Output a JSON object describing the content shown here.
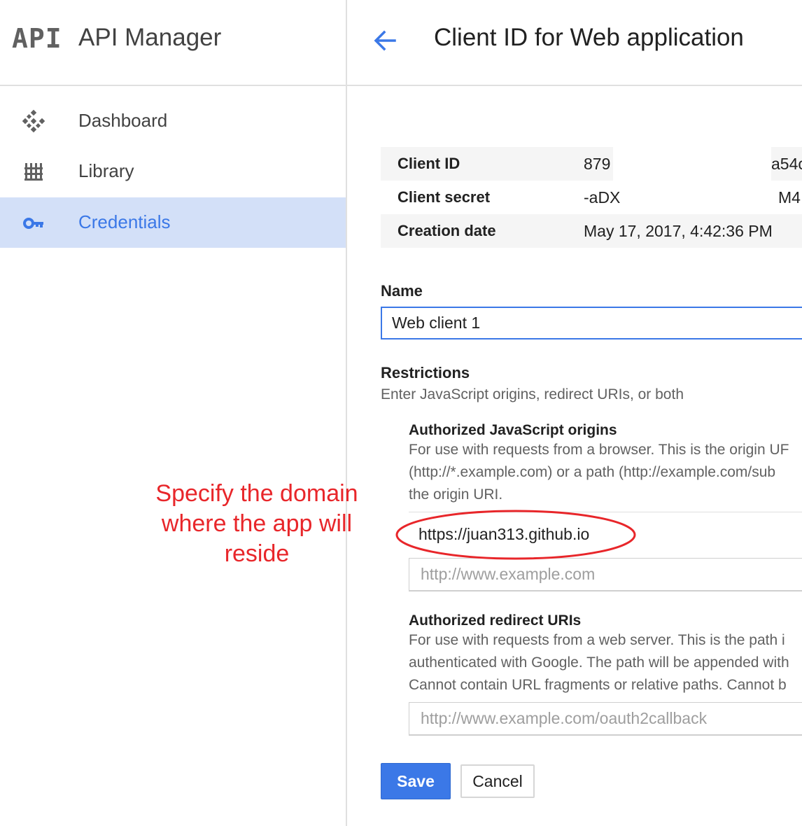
{
  "sidebar": {
    "logo": "API",
    "title": "API Manager",
    "items": [
      {
        "label": "Dashboard",
        "icon": "dashboard-icon"
      },
      {
        "label": "Library",
        "icon": "library-icon"
      },
      {
        "label": "Credentials",
        "icon": "key-icon",
        "active": true
      }
    ]
  },
  "header": {
    "title": "Client ID for Web application",
    "back_icon": "arrow-back-icon"
  },
  "info": {
    "rows": [
      {
        "key": "Client ID",
        "value": "879",
        "value_tail": "a54c"
      },
      {
        "key": "Client secret",
        "value": "-aDX",
        "value_tail": "M4"
      },
      {
        "key": "Creation date",
        "value": "May 17, 2017, 4:42:36 PM"
      }
    ]
  },
  "name": {
    "label": "Name",
    "value": "Web client 1"
  },
  "restrictions": {
    "title": "Restrictions",
    "description": "Enter JavaScript origins, redirect URIs, or both",
    "js_origins": {
      "title": "Authorized JavaScript origins",
      "help": [
        "For use with requests from a browser. This is the origin UF",
        "(http://*.example.com) or a path (http://example.com/sub",
        "the origin URI."
      ],
      "value": "https://juan313.github.io",
      "placeholder": "http://www.example.com"
    },
    "redirect_uris": {
      "title": "Authorized redirect URIs",
      "help": [
        "For use with requests from a web server. This is the path i",
        "authenticated with Google. The path will be appended with",
        "Cannot contain URL fragments or relative paths. Cannot b"
      ],
      "placeholder": "http://www.example.com/oauth2callback"
    }
  },
  "actions": {
    "save": "Save",
    "cancel": "Cancel"
  },
  "annotation": {
    "lines": [
      "Specify the domain",
      "where the app will",
      "reside"
    ],
    "color": "#e8262a"
  },
  "colors": {
    "accent": "#3b78e7",
    "active_bg": "#d3e0f8"
  }
}
